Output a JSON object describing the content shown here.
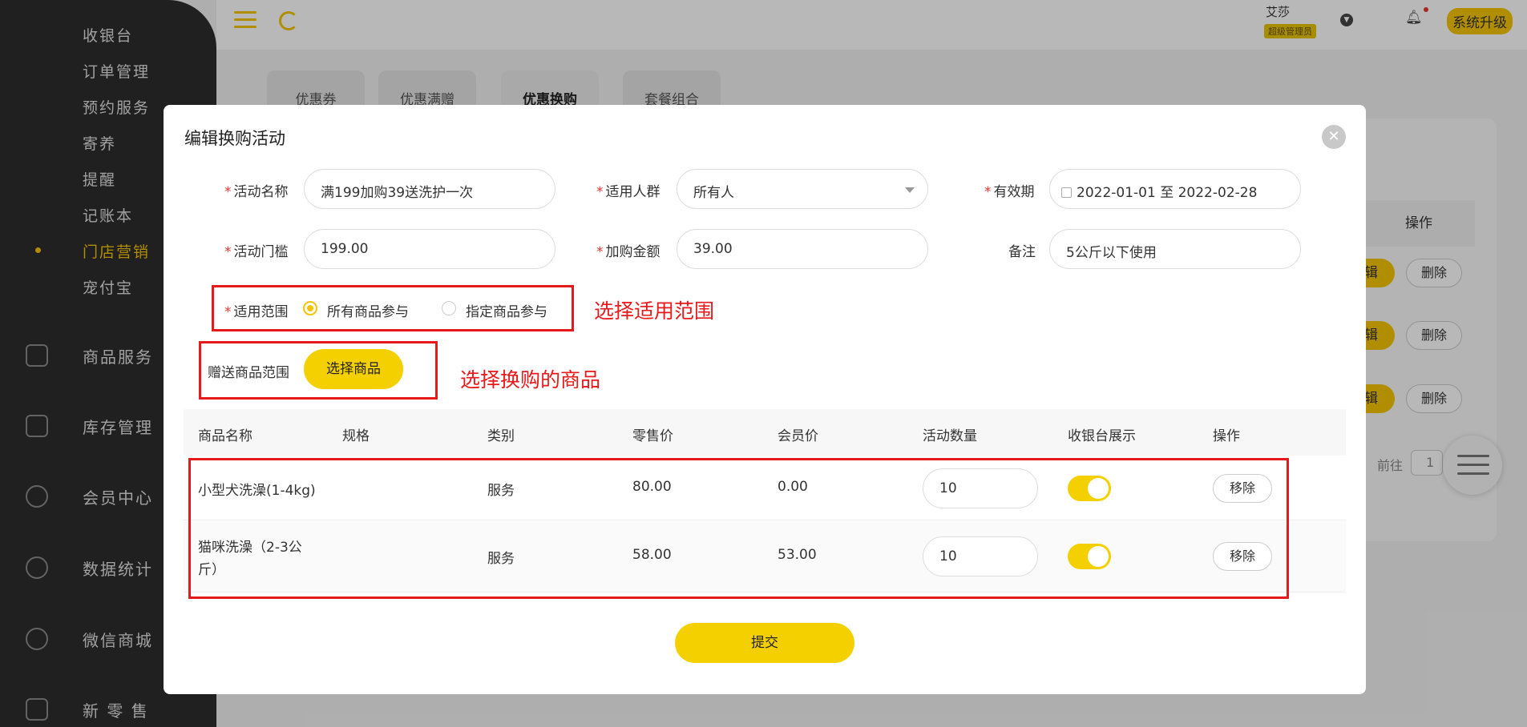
{
  "sidebar": {
    "items": [
      {
        "label": "收银台"
      },
      {
        "label": "订单管理"
      },
      {
        "label": "预约服务"
      },
      {
        "label": "寄养"
      },
      {
        "label": "提醒"
      },
      {
        "label": "记账本"
      },
      {
        "label": "门店营销",
        "active": true
      },
      {
        "label": "宠付宝"
      }
    ],
    "groups": [
      {
        "label": "商品服务",
        "icon": "bag-icon"
      },
      {
        "label": "库存管理",
        "icon": "box-icon"
      },
      {
        "label": "会员中心",
        "icon": "member-icon"
      },
      {
        "label": "数据统计",
        "icon": "chart-icon"
      },
      {
        "label": "微信商城",
        "icon": "wechat-icon"
      },
      {
        "label": "新 零 售",
        "icon": "package-icon"
      }
    ]
  },
  "topbar": {
    "user_name": "艾莎",
    "user_role": "超级管理员",
    "upgrade_label": "系统升级"
  },
  "background": {
    "tabs": [
      "优惠券",
      "优惠满赠",
      "优惠换购",
      "套餐组合"
    ],
    "active_tab": 2,
    "table_header_action": "操作",
    "edit_label": "辑",
    "delete_label": "删除",
    "goto_label": "前往",
    "goto_value": "1"
  },
  "modal": {
    "title": "编辑换购活动",
    "fields": {
      "name_label": "活动名称",
      "name_value": "满199加购39送洗护一次",
      "crowd_label": "适用人群",
      "crowd_value": "所有人",
      "validity_label": "有效期",
      "validity_value": "2022-01-01 至 2022-02-28",
      "threshold_label": "活动门槛",
      "threshold_value": "199.00",
      "addon_label": "加购金额",
      "addon_value": "39.00",
      "remark_label": "备注",
      "remark_value": "5公斤以下使用",
      "scope_label": "适用范围",
      "scope_option_all": "所有商品参与",
      "scope_option_specific": "指定商品参与",
      "gift_scope_label": "赠送商品范围",
      "select_goods_label": "选择商品"
    },
    "annotations": {
      "scope_note": "选择适用范围",
      "goods_note": "选择换购的商品"
    },
    "table": {
      "headers": [
        "商品名称",
        "规格",
        "类别",
        "零售价",
        "会员价",
        "活动数量",
        "收银台展示",
        "操作"
      ],
      "rows": [
        {
          "name": "小型犬洗澡(1-4kg)",
          "name_line2": "",
          "spec": "",
          "category": "服务",
          "retail": "80.00",
          "member": "0.00",
          "qty": "10",
          "show": true,
          "action": "移除"
        },
        {
          "name": "猫咪洗澡（2-3公",
          "name_line2": "斤）",
          "spec": "",
          "category": "服务",
          "retail": "58.00",
          "member": "53.00",
          "qty": "10",
          "show": true,
          "action": "移除"
        }
      ]
    },
    "submit_label": "提交"
  },
  "colors": {
    "accent": "#f5d000",
    "sidebar_bg": "#2d2d2d",
    "annotation_red": "#e8191b"
  }
}
